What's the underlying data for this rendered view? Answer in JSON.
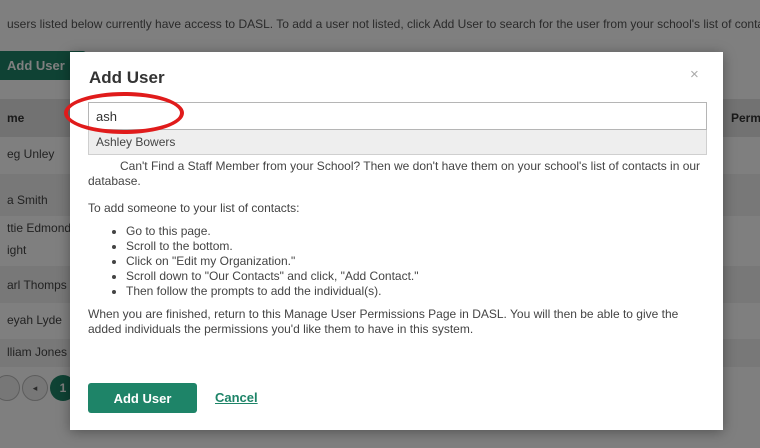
{
  "background": {
    "intro_text": "users listed below currently have access to DASL. To add a user not listed, click Add User to search for the user from your school's list of contacts",
    "add_user_label": "Add User",
    "columns": {
      "name": "me",
      "permissions": "Permi"
    },
    "rows": [
      "eg Unley",
      "a Smith",
      "ttie Edmond",
      "ight",
      "arl Thomps",
      "eyah Lyde",
      "lliam Jones"
    ],
    "pager": {
      "prev_icon": "◂",
      "current_page": "1"
    }
  },
  "modal": {
    "title": "Add User",
    "close_icon": "×",
    "search": {
      "value": "ash",
      "placeholder": ""
    },
    "suggestions": [
      "Ashley Bowers"
    ],
    "body": {
      "cant_find": "Can't Find a Staff Member from your School? Then we don't have them on your school's list of contacts in our database.",
      "how_to": "To add someone to your list of contacts:",
      "steps": [
        "Go to this page.",
        "Scroll to the bottom.",
        "Click on \"Edit my Organization.\"",
        "Scroll down to \"Our Contacts\" and click, \"Add Contact.\"",
        "Then follow the prompts to add the individual(s)."
      ],
      "when_done": "When you are finished, return to this Manage User Permissions Page in DASL. You will then be able to give the added individuals the permissions you'd like them to have in this system."
    },
    "buttons": {
      "add_user": "Add User",
      "cancel": "Cancel"
    }
  },
  "colors": {
    "accent": "#1e8468",
    "highlight_ring": "#e01b1b"
  }
}
